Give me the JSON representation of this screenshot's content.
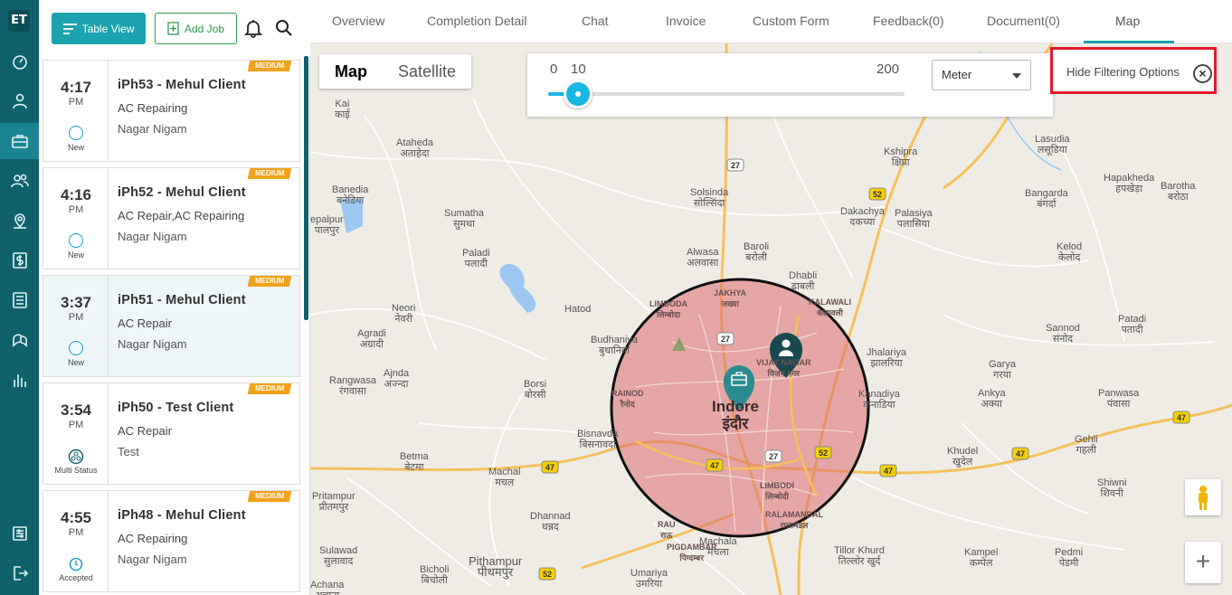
{
  "app": {
    "logo": "ET"
  },
  "rail": {
    "items": [
      {
        "icon": "dashboard-icon"
      },
      {
        "icon": "user-icon"
      },
      {
        "icon": "briefcase-icon",
        "active": true
      },
      {
        "icon": "users-icon"
      },
      {
        "icon": "map-pin-icon"
      },
      {
        "icon": "dollar-icon"
      },
      {
        "icon": "list-icon"
      },
      {
        "icon": "chat-icon"
      },
      {
        "icon": "bar-chart-icon"
      },
      {
        "icon": "settings-icon"
      },
      {
        "icon": "logout-icon"
      }
    ]
  },
  "toolbar": {
    "table_view_label": "Table View",
    "add_job_label": "Add Job",
    "icons": [
      "list-lines-icon",
      "plus-file-icon",
      "bell-icon",
      "search-icon"
    ]
  },
  "jobs": [
    {
      "time": "4:17",
      "ampm": "PM",
      "status": "New",
      "priority": "MEDIUM",
      "title": "iPh53 - Mehul Client",
      "service": "AC Repairing",
      "location": "Nagar Nigam"
    },
    {
      "time": "4:16",
      "ampm": "PM",
      "status": "New",
      "priority": "MEDIUM",
      "title": "iPh52 - Mehul Client",
      "service": "AC Repair,AC Repairing",
      "location": "Nagar Nigam"
    },
    {
      "time": "3:37",
      "ampm": "PM",
      "status": "New",
      "priority": "MEDIUM",
      "title": "iPh51 - Mehul Client",
      "service": "AC Repair",
      "location": "Nagar Nigam",
      "selected": true
    },
    {
      "time": "3:54",
      "ampm": "PM",
      "status": "Multi Status",
      "priority": "MEDIUM",
      "title": "iPh50 - Test Client",
      "service": "AC Repair",
      "location": "Test"
    },
    {
      "time": "4:55",
      "ampm": "PM",
      "status": "Accepted",
      "priority": "MEDIUM",
      "title": "iPh48 - Mehul Client",
      "service": "AC Repairing",
      "location": "Nagar Nigam"
    }
  ],
  "tabs": [
    {
      "label": "Overview"
    },
    {
      "label": "Completion Detail"
    },
    {
      "label": "Chat"
    },
    {
      "label": "Invoice"
    },
    {
      "label": "Custom Form"
    },
    {
      "label": "Feedback(0)"
    },
    {
      "label": "Document(0)"
    },
    {
      "label": "Map",
      "active": true
    }
  ],
  "map": {
    "type_buttons": {
      "map": "Map",
      "satellite": "Satellite",
      "selected": "Map"
    },
    "radius_slider": {
      "min_label": "0",
      "value_label": "10",
      "max_label": "200",
      "value": 10,
      "min": 0,
      "max": 200
    },
    "unit_select": {
      "value": "Meter"
    },
    "hide_filter": {
      "label": "Hide Filtering Options"
    },
    "zoom_in": "+",
    "labels": {
      "kai": "Kai\nकाई",
      "ataheda": "Ataheda\nअताहेदा",
      "banedia": "Banedia\nबनेडिया",
      "palpur": "epalpur\nपालपुर",
      "sumatha": "Sumatha\nसुमथा",
      "paladi": "Paladi\nपलादी",
      "solsinda": "Solsinda\nसोल्सिंदा",
      "kshipra": "Kshipra\nक्षिप्रा",
      "lasudia": "Lasudia\nलसूडिया",
      "hapakheda": "Hapakheda\nहपखेड़ा",
      "barotha": "Barotha\nबरोठा",
      "bangarda": "Bangarda\nबंगर्दा",
      "dakachya": "Dakachya\nदकच्या",
      "palasiya": "Palasiya\nपलासिया",
      "baroli": "Baroli\nबरोली",
      "alwasa": "Alwasa\nअलवासा",
      "dhabli": "Dhabli\nढाबली",
      "kelod": "Kelod\nकेलोद",
      "neori": "Neori\nनेवरी",
      "hatod": "Hatod",
      "limbodaN": "LIMBODA\nलिम्बोदा",
      "jakhya": "JAKHYA\nजख्या",
      "kalawali": "KALAWALI\nकलावली",
      "agradi": "Agradi\nअग्रादी",
      "budhaniya": "Budhaniya\nबुधानिया",
      "vijaynagar": "VIJAY NAGAR\nविजय नगर",
      "jhalariya": "Jhalariya\nझालरिया",
      "sannod": "Sannod\nसंनोद",
      "patadi": "Patadi\nपतादी",
      "rangwasa": "Rangwasa\nरंगवासा",
      "ajnda": "Ajnda\nअज्न्दा",
      "garya": "Garya\nगरया",
      "borsi": "Borsi\nबोरसी",
      "rainod": "RAINOD\nरैनोद",
      "indore": "Indore\nइंदौर",
      "kanadiya": "Kanadiya\nकनाडिया",
      "ankya": "Ankya\nअक्या",
      "panwasa": "Panwasa\nपंवासा",
      "bisnavda": "Bisnavda\nबिसनावदा",
      "gehli": "Gehli\nगहली",
      "betma": "Betma\nबेटमा",
      "khudel": "Khudel\nखुदेल",
      "machal": "Machal\nमचल",
      "pritampur": "Pritampur\nप्रीतमपुर",
      "limbodiS": "LIMBODI\nलिम्बोदी",
      "shiwni": "Shiwni\nशिवनी",
      "dhannad": "Dhannad\nधन्नद",
      "ralamandal": "RALAMANDAL\nरालामंडल",
      "rau": "RAU\nराऊ",
      "sulawad": "Sulawad\nसुलावाद",
      "pigdambar": "PIGDAMBAR\nपिग्दम्बर",
      "machala": "Machala\nमचला",
      "tillor": "Tillor Khurd\nतिल्लोर खुर्द",
      "kampel": "Kampel\nकम्पेल",
      "pedmi": "Pedmi\nपेडमी",
      "bicholi": "Bicholi\nबिचोली",
      "pithampur": "Pithampur\nपीथमपुर",
      "umariya": "Umariya\nउमरिया",
      "achana": "Achana\nअचाना"
    },
    "roads": [
      "27",
      "52",
      "47"
    ]
  }
}
